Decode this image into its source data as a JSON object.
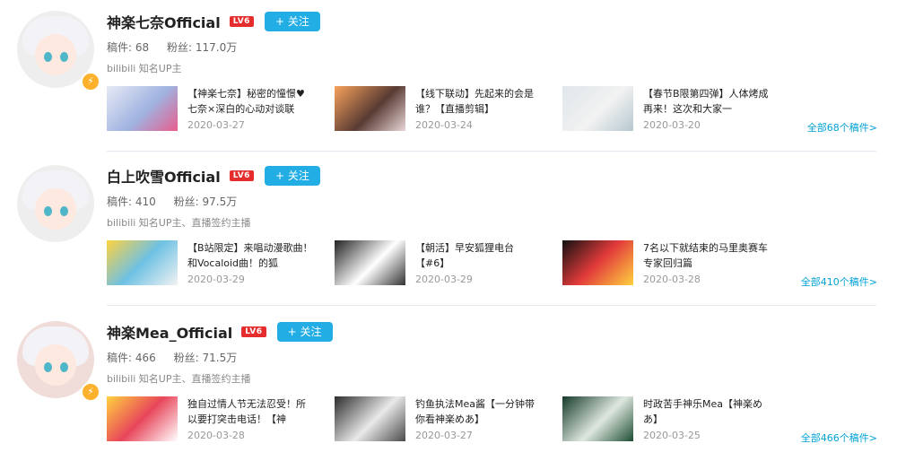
{
  "users": [
    {
      "name": "神楽七奈Official",
      "level": "LV6",
      "follow_label": "+ 关注",
      "stats": {
        "works_label": "稿件:",
        "works": "68",
        "fans_label": "粉丝:",
        "fans": "117.0万"
      },
      "desc": "bilibili 知名UP主",
      "videos": [
        {
          "title": "【神楽七奈】秘密的憧憬♥七奈×深白的心动对谈联",
          "date": "2020-03-27"
        },
        {
          "title": "【线下联动】先起来的会是谁？【直播剪辑】",
          "date": "2020-03-24"
        },
        {
          "title": "【春节B限第四弹】人体烤成再来！这次和大家一",
          "date": "2020-03-20"
        }
      ],
      "more": "全部68个稿件>"
    },
    {
      "name": "白上吹雪Official",
      "level": "LV6",
      "follow_label": "+ 关注",
      "stats": {
        "works_label": "稿件:",
        "works": "410",
        "fans_label": "粉丝:",
        "fans": "97.5万"
      },
      "desc": "bilibili 知名UP主、直播签约主播",
      "videos": [
        {
          "title": "【B站限定】来唱动漫歌曲！和Vocaloid曲！的狐",
          "date": "2020-03-29"
        },
        {
          "title": "【朝活】早安狐狸电台【#6】",
          "date": "2020-03-29"
        },
        {
          "title": "7名以下就结束的马里奥赛车 专家回归篇",
          "date": "2020-03-28"
        }
      ],
      "more": "全部410个稿件>"
    },
    {
      "name": "神楽Mea_Official",
      "level": "LV6",
      "follow_label": "+ 关注",
      "stats": {
        "works_label": "稿件:",
        "works": "466",
        "fans_label": "粉丝:",
        "fans": "71.5万"
      },
      "desc": "bilibili 知名UP主、直播签约主播",
      "videos": [
        {
          "title": "独自过情人节无法忍受！所以要打突击电话！【神",
          "date": "2020-03-28"
        },
        {
          "title": "钓鱼执法Mea酱【一分钟带你看神楽めあ】",
          "date": "2020-03-27"
        },
        {
          "title": "时政苦手神乐Mea【神楽めあ】",
          "date": "2020-03-25"
        }
      ],
      "more": "全部466个稿件>"
    }
  ],
  "colors": {
    "accent": "#23ade5",
    "level_badge": "#e52d2d",
    "link": "#00a1d6",
    "verified": "#fbb12b"
  }
}
